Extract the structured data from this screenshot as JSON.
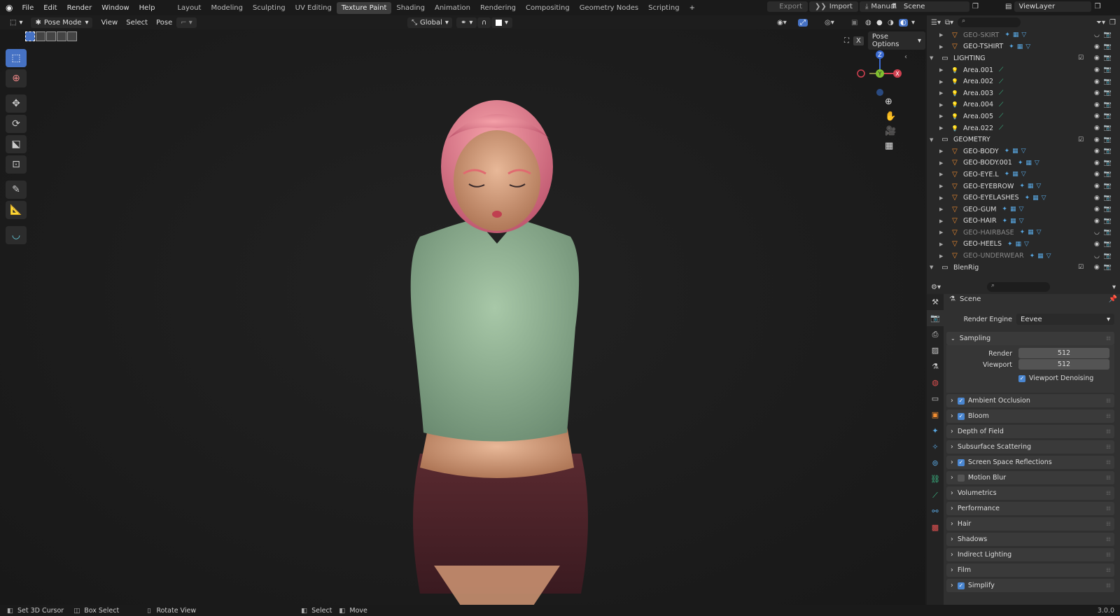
{
  "topbar": {
    "menus": [
      "File",
      "Edit",
      "Render",
      "Window",
      "Help"
    ],
    "workspaces": [
      "Layout",
      "Modeling",
      "Sculpting",
      "UV Editing",
      "Texture Paint",
      "Shading",
      "Animation",
      "Rendering",
      "Compositing",
      "Geometry Nodes",
      "Scripting"
    ],
    "active_workspace": "Texture Paint",
    "export_label": "Export",
    "import_label": "Import",
    "manual_label": "Manual",
    "scene": "Scene",
    "view_layer": "ViewLayer"
  },
  "viewport_header": {
    "mode": "Pose Mode",
    "menus": [
      "View",
      "Select",
      "Pose"
    ],
    "orientation": "Global",
    "pose_options": "Pose Options"
  },
  "gizmo": {
    "z": "Z",
    "y": "Y",
    "x": "X"
  },
  "outliner": {
    "rows": [
      {
        "label": "GEO-SKIRT",
        "depth": 2,
        "icon": "mesh",
        "dim": true,
        "collapsed": true
      },
      {
        "label": "GEO-TSHIRT",
        "depth": 2,
        "icon": "mesh",
        "dim": false,
        "collapsed": true
      },
      {
        "label": "LIGHTING",
        "depth": 1,
        "icon": "collection",
        "dim": false,
        "collapsed": false
      },
      {
        "label": "Area.001",
        "depth": 2,
        "icon": "light",
        "dim": false,
        "collapsed": true
      },
      {
        "label": "Area.002",
        "depth": 2,
        "icon": "light",
        "dim": false,
        "collapsed": true
      },
      {
        "label": "Area.003",
        "depth": 2,
        "icon": "light",
        "dim": false,
        "collapsed": true
      },
      {
        "label": "Area.004",
        "depth": 2,
        "icon": "light",
        "dim": false,
        "collapsed": true
      },
      {
        "label": "Area.005",
        "depth": 2,
        "icon": "light",
        "dim": false,
        "collapsed": true
      },
      {
        "label": "Area.022",
        "depth": 2,
        "icon": "light",
        "dim": false,
        "collapsed": true
      },
      {
        "label": "GEOMETRY",
        "depth": 1,
        "icon": "collection",
        "dim": false,
        "collapsed": false
      },
      {
        "label": "GEO-BODY",
        "depth": 2,
        "icon": "mesh",
        "dim": false,
        "collapsed": true
      },
      {
        "label": "GEO-BODY.001",
        "depth": 2,
        "icon": "mesh",
        "dim": false,
        "collapsed": true
      },
      {
        "label": "GEO-EYE.L",
        "depth": 2,
        "icon": "mesh",
        "dim": false,
        "collapsed": true
      },
      {
        "label": "GEO-EYEBROW",
        "depth": 2,
        "icon": "mesh",
        "dim": false,
        "collapsed": true
      },
      {
        "label": "GEO-EYELASHES",
        "depth": 2,
        "icon": "mesh",
        "dim": false,
        "collapsed": true
      },
      {
        "label": "GEO-GUM",
        "depth": 2,
        "icon": "mesh",
        "dim": false,
        "collapsed": true
      },
      {
        "label": "GEO-HAIR",
        "depth": 2,
        "icon": "mesh",
        "dim": false,
        "collapsed": true
      },
      {
        "label": "GEO-HAIRBASE",
        "depth": 2,
        "icon": "mesh",
        "dim": true,
        "collapsed": true
      },
      {
        "label": "GEO-HEELS",
        "depth": 2,
        "icon": "mesh",
        "dim": false,
        "collapsed": true
      },
      {
        "label": "GEO-UNDERWEAR",
        "depth": 2,
        "icon": "mesh",
        "dim": true,
        "collapsed": true
      },
      {
        "label": "BlenRig",
        "depth": 1,
        "icon": "collection",
        "dim": false,
        "collapsed": false
      }
    ]
  },
  "properties": {
    "context": "Scene",
    "render_engine_label": "Render Engine",
    "render_engine": "Eevee",
    "sampling": {
      "title": "Sampling",
      "render_label": "Render",
      "render_value": "512",
      "viewport_label": "Viewport",
      "viewport_value": "512",
      "denoise_label": "Viewport Denoising",
      "denoise": true
    },
    "panels": [
      {
        "label": "Ambient Occlusion",
        "checkbox": true,
        "checked": true
      },
      {
        "label": "Bloom",
        "checkbox": true,
        "checked": true
      },
      {
        "label": "Depth of Field",
        "checkbox": false,
        "checked": false
      },
      {
        "label": "Subsurface Scattering",
        "checkbox": false,
        "checked": false
      },
      {
        "label": "Screen Space Reflections",
        "checkbox": true,
        "checked": true
      },
      {
        "label": "Motion Blur",
        "checkbox": true,
        "checked": false
      },
      {
        "label": "Volumetrics",
        "checkbox": false,
        "checked": false
      },
      {
        "label": "Performance",
        "checkbox": false,
        "checked": false
      },
      {
        "label": "Hair",
        "checkbox": false,
        "checked": false
      },
      {
        "label": "Shadows",
        "checkbox": false,
        "checked": false
      },
      {
        "label": "Indirect Lighting",
        "checkbox": false,
        "checked": false
      },
      {
        "label": "Film",
        "checkbox": false,
        "checked": false
      },
      {
        "label": "Simplify",
        "checkbox": true,
        "checked": true
      }
    ]
  },
  "statusbar": {
    "items": [
      "Set 3D Cursor",
      "Box Select",
      "Rotate View",
      "Select",
      "Move"
    ],
    "version": "3.0.0"
  },
  "colors": {
    "accent": "#4672c4",
    "checkbox": "#4a86d0",
    "object_icon": "#f08c30",
    "modifier_icon": "#58a6e0",
    "mesh_data_icon": "#3cc48c"
  }
}
